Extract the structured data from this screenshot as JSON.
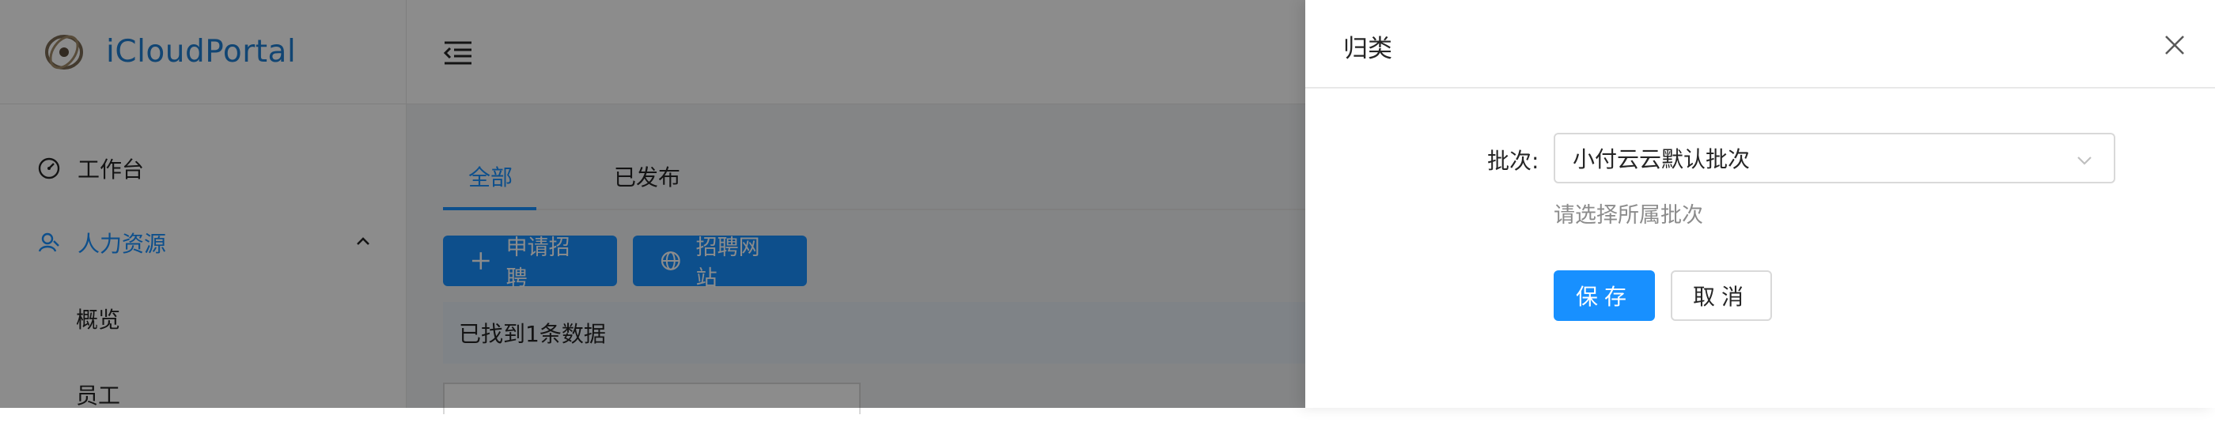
{
  "app": {
    "logo_text": "iCloudPortal"
  },
  "sidebar": {
    "workbench": "工作台",
    "hr": "人力资源",
    "hr_children": [
      "概览",
      "员工"
    ]
  },
  "main": {
    "tabs": [
      "全部",
      "已发布"
    ],
    "buttons": {
      "apply_recruit": "申请招聘",
      "recruit_site": "招聘网站"
    },
    "result_text": "已找到1条数据"
  },
  "drawer": {
    "title": "归类",
    "batch_label": "批次:",
    "batch_value": "小付云云默认批次",
    "batch_help": "请选择所属批次",
    "save_label": "保存",
    "cancel_label": "取消"
  },
  "icons": {
    "logo": "logo-mark-icon",
    "workbench": "dashboard-icon",
    "hr": "user-icon",
    "toggle": "menu-fold-icon",
    "add": "plus-icon",
    "site": "globe-icon",
    "close": "close-icon",
    "select_arrow": "chevron-down-icon"
  },
  "colors": {
    "primary": "#1890ff",
    "logo": "#1f7fd1",
    "mask": "rgba(0,0,0,0.45)"
  }
}
